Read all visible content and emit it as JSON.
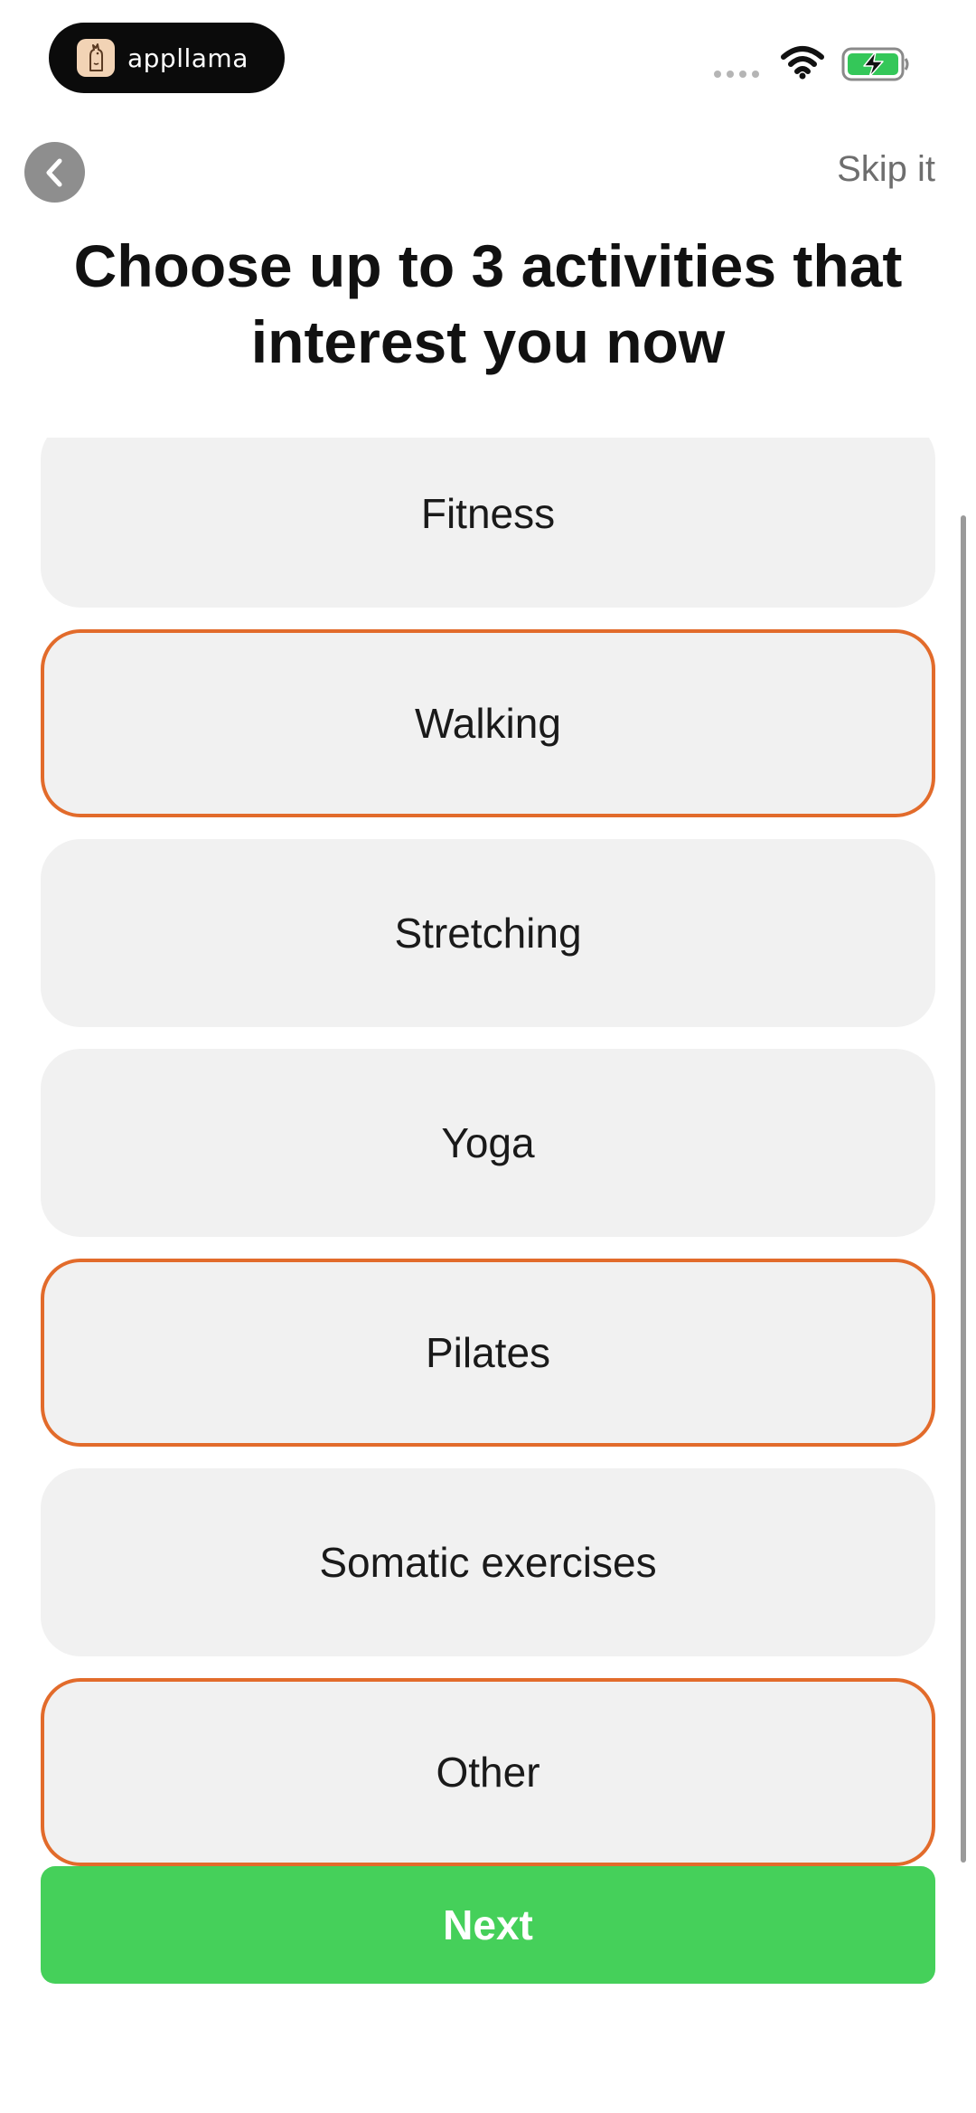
{
  "status_bar": {
    "brand_name": "appllama",
    "brand_icon": "llama-icon",
    "wifi_icon": "wifi-icon",
    "battery_icon": "battery-charging-icon",
    "battery_color": "#34c759"
  },
  "header": {
    "back_icon": "chevron-left-icon",
    "skip_label": "Skip it",
    "title": "Choose up to 3 activities that interest you now"
  },
  "options": [
    {
      "label": "Fitness",
      "selected": false
    },
    {
      "label": "Walking",
      "selected": true
    },
    {
      "label": "Stretching",
      "selected": false
    },
    {
      "label": "Yoga",
      "selected": false
    },
    {
      "label": "Pilates",
      "selected": true
    },
    {
      "label": "Somatic exercises",
      "selected": false
    },
    {
      "label": "Other",
      "selected": true
    }
  ],
  "next_label": "Next",
  "colors": {
    "accent_selected": "#e26b2b",
    "primary_button": "#45d05a",
    "card_background": "#f1f1f1"
  }
}
